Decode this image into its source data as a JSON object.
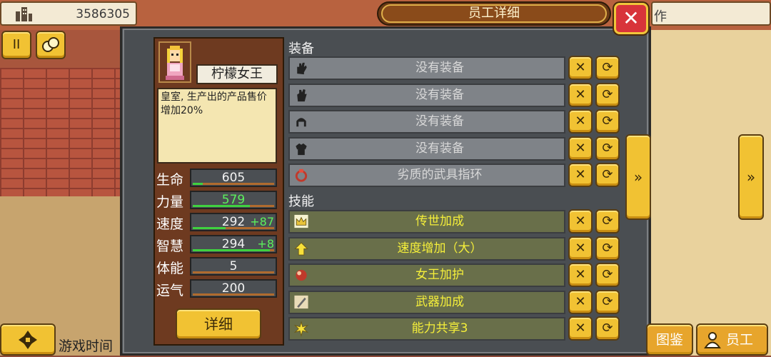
{
  "hud": {
    "money": "3586305",
    "top_right_label": "作",
    "game_time_label": "游戏时间",
    "pedia_label": "图鉴",
    "staff_label": "员工"
  },
  "dialog": {
    "title": "员工详细",
    "close_glyph": "✕"
  },
  "character": {
    "name": "柠檬女王",
    "description": "皇室, 生产出的产品售价增加20%",
    "detail_button": "详细",
    "stats": [
      {
        "label": "生命",
        "value": "605",
        "bonus": "",
        "fill": 0.12
      },
      {
        "label": "力量",
        "value": "579",
        "bonus": "",
        "fill": 0.7,
        "highlight": true
      },
      {
        "label": "速度",
        "value": "292",
        "bonus": "+87",
        "fill": 0.4
      },
      {
        "label": "智慧",
        "value": "294",
        "bonus": "+8",
        "fill": 0.95
      },
      {
        "label": "体能",
        "value": "5",
        "bonus": "",
        "fill": 0.0
      },
      {
        "label": "运气",
        "value": "200",
        "bonus": "",
        "fill": 0.0
      }
    ]
  },
  "equipment": {
    "header": "装备",
    "items": [
      {
        "label": "没有装备",
        "icon": "glove-icon"
      },
      {
        "label": "没有装备",
        "icon": "gauntlet-icon"
      },
      {
        "label": "没有装备",
        "icon": "helmet-icon"
      },
      {
        "label": "没有装备",
        "icon": "armor-icon"
      },
      {
        "label": "劣质的武具指环",
        "icon": "ring-icon"
      }
    ]
  },
  "skills": {
    "header": "技能",
    "items": [
      {
        "label": "传世加成",
        "icon": "crown-icon"
      },
      {
        "label": "速度增加（大）",
        "icon": "arrow-up-icon"
      },
      {
        "label": "女王加护",
        "icon": "orb-icon"
      },
      {
        "label": "武器加成",
        "icon": "sword-icon"
      },
      {
        "label": "能力共享3",
        "icon": "burst-icon"
      }
    ]
  },
  "buttons": {
    "remove_glyph": "✕",
    "swap_glyph": "⟳",
    "prev_glyph": "«",
    "next_glyph": "»",
    "pause_glyph": "II"
  }
}
